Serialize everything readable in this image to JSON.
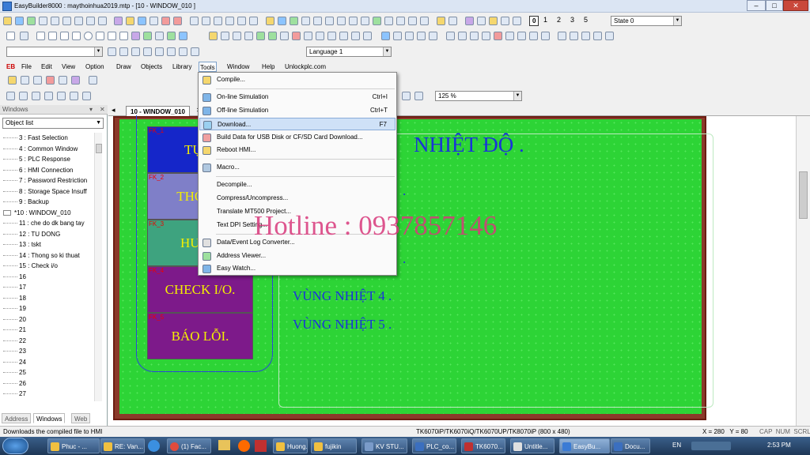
{
  "window": {
    "title": "EasyBuilder8000 : maythoinhua2019.mtp - [10 - WINDOW_010 ]",
    "min": "–",
    "max": "□",
    "close": "✕"
  },
  "toolbar": {
    "page_buttons": [
      "0",
      "1",
      "2",
      "3",
      "5"
    ],
    "state_value": "State 0",
    "language_value": "Language 1",
    "layers": [
      "L1",
      "L2",
      "L3",
      "L4"
    ],
    "zoom_value": "125 %"
  },
  "menubar": {
    "logo": "EB",
    "items": [
      "File",
      "Edit",
      "View",
      "Option",
      "Draw",
      "Objects",
      "Library",
      "Tools",
      "Window",
      "Help",
      "Unlockplc.com"
    ]
  },
  "tools_menu": [
    {
      "label": "Compile...",
      "shortcut": ""
    },
    {
      "label": "On-line Simulation",
      "shortcut": "Ctrl+I"
    },
    {
      "label": "Off-line Simulation",
      "shortcut": "Ctrl+T"
    },
    {
      "label": "Download...",
      "shortcut": "F7"
    },
    {
      "label": "Build Data for USB Disk or CF/SD Card Download...",
      "shortcut": ""
    },
    {
      "label": "Reboot HMI...",
      "shortcut": ""
    },
    {
      "label": "Macro...",
      "shortcut": ""
    },
    {
      "label": "Decompile...",
      "shortcut": ""
    },
    {
      "label": "Compress/Uncompress...",
      "shortcut": ""
    },
    {
      "label": "Translate MT500 Project...",
      "shortcut": ""
    },
    {
      "label": "Text DPI Setting...",
      "shortcut": ""
    },
    {
      "label": "Data/Event Log Converter...",
      "shortcut": ""
    },
    {
      "label": "Address Viewer...",
      "shortcut": ""
    },
    {
      "label": "Easy Watch...",
      "shortcut": ""
    }
  ],
  "windows_panel": {
    "title": "Windows",
    "close": "✕",
    "pin": "▾",
    "list_label": "Object list",
    "tree": [
      "3 : Fast Selection",
      "4 : Common Window",
      "5 : PLC Response",
      "6 : HMI Connection",
      "7 : Password Restriction",
      "8 : Storage Space Insuff",
      "9 : Backup",
      "*10 : WINDOW_010",
      "11 : che do dk bang tay",
      "12 : TU DONG",
      "13 : tskt",
      "14 : Thong so ki thuat",
      "15 : Check i/o",
      "16",
      "17",
      "18",
      "19",
      "20",
      "21",
      "22",
      "23",
      "24",
      "25",
      "26",
      "27"
    ],
    "bottom_tabs": [
      "Address",
      "Windows",
      "Web"
    ]
  },
  "doc_tab": "10 - WINDOW_010",
  "doc_tab_close": "✕",
  "screen": {
    "function_keys": [
      {
        "id": "FK_1",
        "text": "TỰ Đ",
        "color": "#1526c9"
      },
      {
        "id": "FK_2",
        "text": "THÔNG",
        "color": "#7f7fc8"
      },
      {
        "id": "FK_3",
        "text": "HƯỚN",
        "color": "#3ea37f"
      },
      {
        "id": "FK_4",
        "text": "CHECK I/O.",
        "color": "#7d1a8a"
      },
      {
        "id": "FK_5",
        "text": "BÁO LỖI.",
        "color": "#7d1a8a"
      }
    ],
    "heading": "NHIỆT ĐỘ .",
    "zone_dot": ".",
    "zones": [
      "VÙNG NHIỆT 4 .",
      "VÙNG NHIỆT 5 ."
    ],
    "watermark": "Hotline : 0937857146"
  },
  "statusbar": {
    "message": "Downloads the compiled file to HMI",
    "model": "TK6070iP/TK6070iQ/TK6070UP/TK8070iP (800 x 480)",
    "coords": "X = 280   Y = 80",
    "indicators": "CAP  NUM  SCRL"
  },
  "taskbar": {
    "items": [
      "Phuc - ...",
      "RE: Van...",
      "(1) Fac...",
      "Huong...",
      "fujikin",
      "KV STU...",
      "PLC_co...",
      "TK6070...",
      "Untitle...",
      "EasyBu...",
      "Docu..."
    ],
    "lang": "EN",
    "time": "2:53 PM"
  }
}
